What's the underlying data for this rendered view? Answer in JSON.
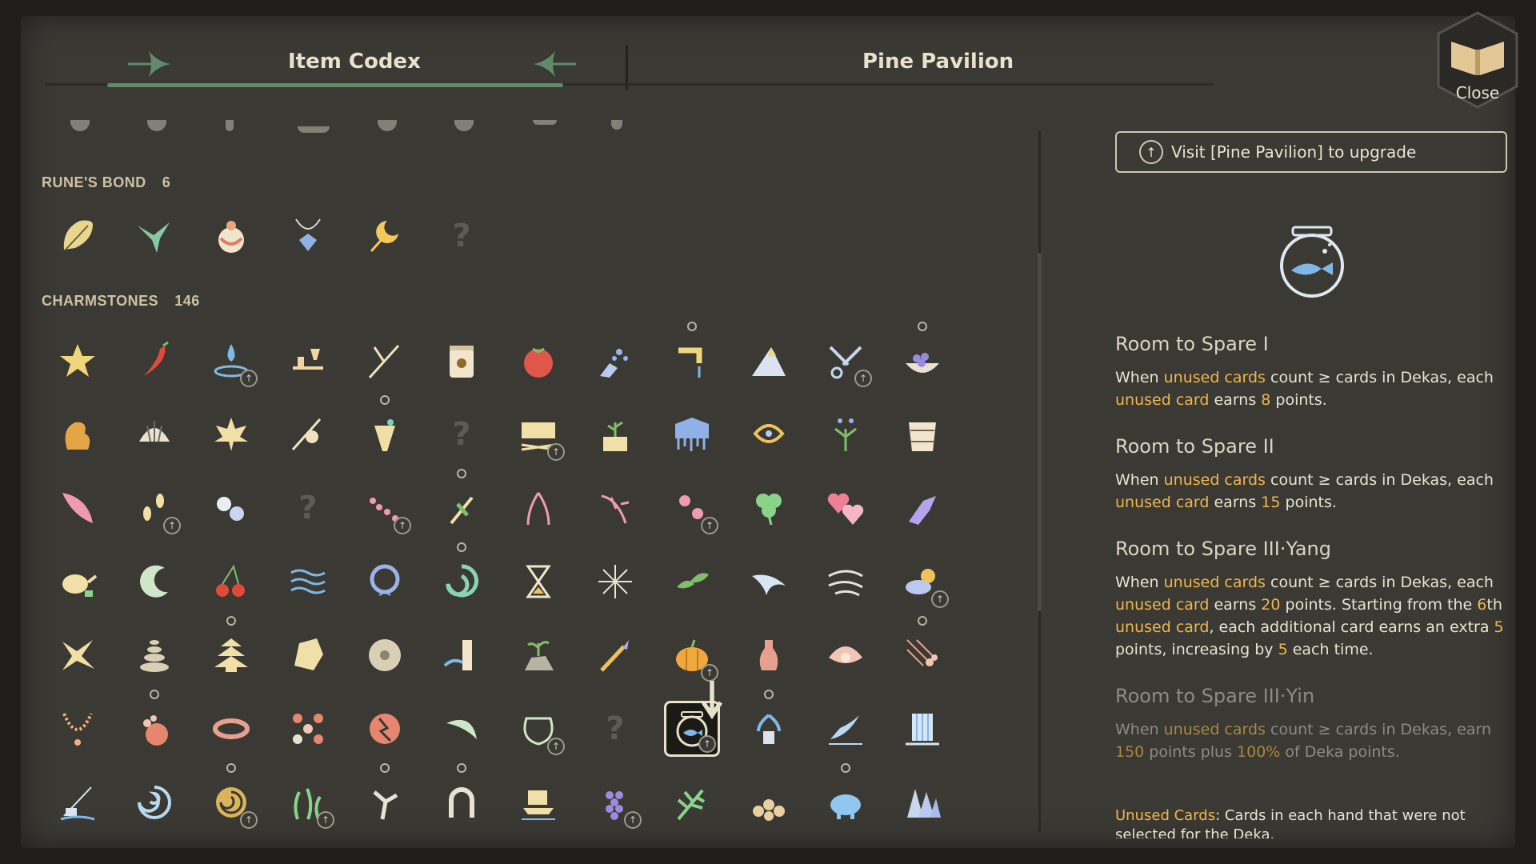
{
  "header": {
    "left_title": "Item Codex",
    "right_title": "Pine Pavilion",
    "close_label": "Close"
  },
  "sections": [
    {
      "label": "RUNE'S BOND",
      "count": "6"
    },
    {
      "label": "CHARMSTONES",
      "count": "146"
    }
  ],
  "unknown_glyph": "?",
  "detail": {
    "visit_button": "Visit [Pine Pavilion] to upgrade",
    "selected_item_icon": "fishbowl-icon",
    "abilities": [
      {
        "title": "Room to Spare I",
        "parts": [
          "When ",
          "unused cards",
          " count ≥ cards in Dekas, each ",
          "unused card",
          " earns ",
          "8",
          " points."
        ]
      },
      {
        "title": "Room to Spare II",
        "parts": [
          "When ",
          "unused cards",
          " count ≥ cards in Dekas, each ",
          "unused card",
          " earns ",
          "15",
          " points."
        ]
      },
      {
        "title": "Room to Spare III·Yang",
        "parts": [
          "When ",
          "unused cards",
          " count ≥ cards in Dekas, each ",
          "unused card",
          " earns ",
          "20",
          " points. Starting from the ",
          "6",
          "th ",
          "unused card",
          ", each additional card earns an extra ",
          "5",
          " points, increasing by ",
          "5",
          " each time."
        ]
      },
      {
        "title": "Room to Spare III·Yin",
        "parts": [
          "When ",
          "unused cards",
          " count ≥ cards in Dekas, earn ",
          "150",
          " points plus ",
          "100%",
          " of Deka points."
        ]
      }
    ],
    "footnote_term": "Unused Cards",
    "footnote_text": ": Cards in each hand that were not selected for the Deka."
  },
  "colors": {
    "highlight": "#f0b64a",
    "panel_bg": "#3a3934",
    "accent_green": "#5f8a6c"
  }
}
